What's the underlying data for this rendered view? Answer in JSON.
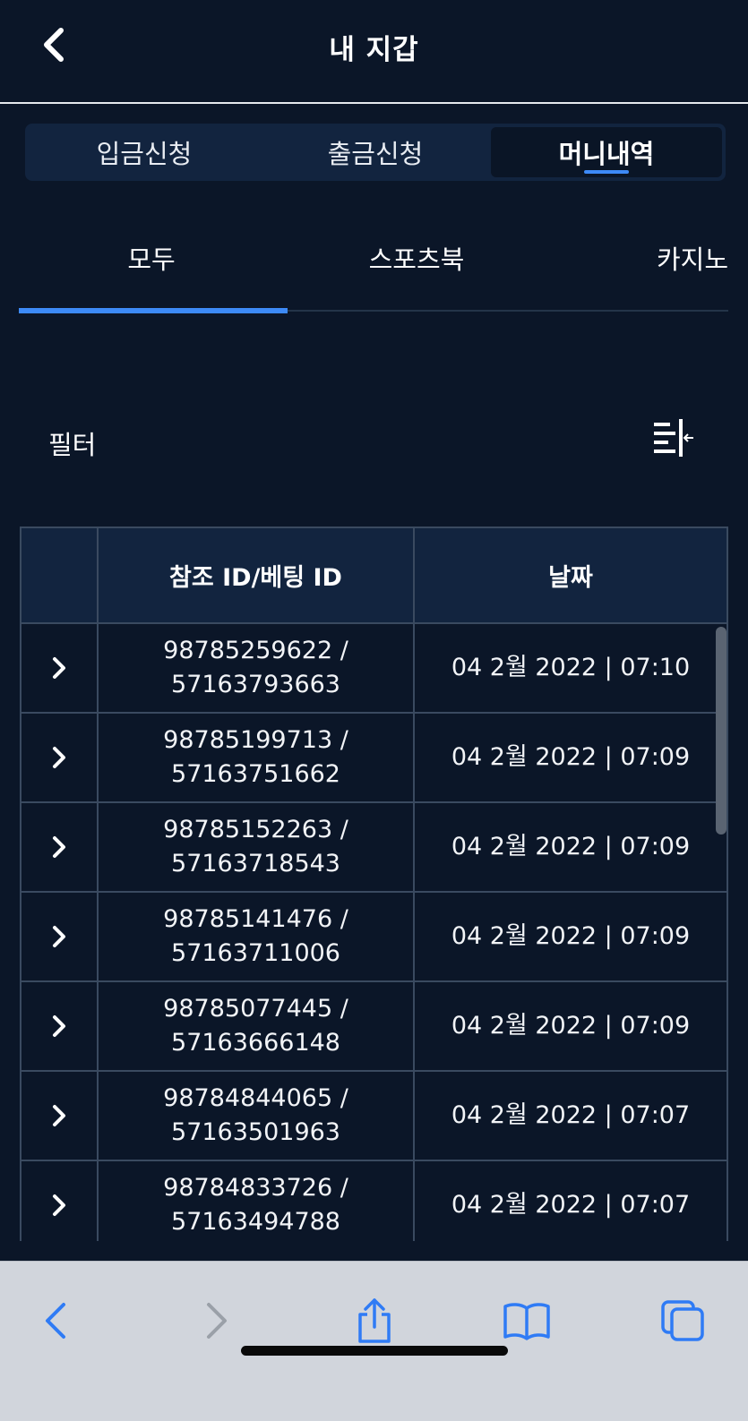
{
  "header": {
    "title": "내 지갑"
  },
  "segments": [
    {
      "label": "입금신청",
      "active": false
    },
    {
      "label": "출금신청",
      "active": false
    },
    {
      "label": "머니내역",
      "active": true
    }
  ],
  "subtabs": [
    {
      "label": "모두",
      "active": true
    },
    {
      "label": "스포츠북",
      "active": false
    },
    {
      "label": "카지노",
      "active": false
    }
  ],
  "filter": {
    "label": "필터"
  },
  "table": {
    "headers": [
      "",
      "참조 ID/베팅 ID",
      "날짜"
    ],
    "rows": [
      {
        "ref": "98785259622 /",
        "bet": "57163793663",
        "date": "04 2월 2022 | 07:10"
      },
      {
        "ref": "98785199713 /",
        "bet": "57163751662",
        "date": "04 2월 2022 | 07:09"
      },
      {
        "ref": "98785152263 /",
        "bet": "57163718543",
        "date": "04 2월 2022 | 07:09"
      },
      {
        "ref": "98785141476 /",
        "bet": "57163711006",
        "date": "04 2월 2022 | 07:09"
      },
      {
        "ref": "98785077445 /",
        "bet": "57163666148",
        "date": "04 2월 2022 | 07:09"
      },
      {
        "ref": "98784844065 /",
        "bet": "57163501963",
        "date": "04 2월 2022 | 07:07"
      },
      {
        "ref": "98784833726 /",
        "bet": "57163494788",
        "date": "04 2월 2022 | 07:07"
      }
    ]
  },
  "icons": {
    "back": "chevron-left-icon",
    "filter": "filter-list-icon",
    "row_expand": "chevron-right-icon",
    "browser_back": "chevron-left-icon",
    "browser_forward": "chevron-right-icon",
    "share": "share-icon",
    "bookmarks": "book-icon",
    "tabs": "tabs-icon"
  },
  "colors": {
    "background": "#0b1628",
    "accent": "#3d8af7",
    "toolbar": "#d1d5dc",
    "safari_blue": "#2f7bf5"
  }
}
